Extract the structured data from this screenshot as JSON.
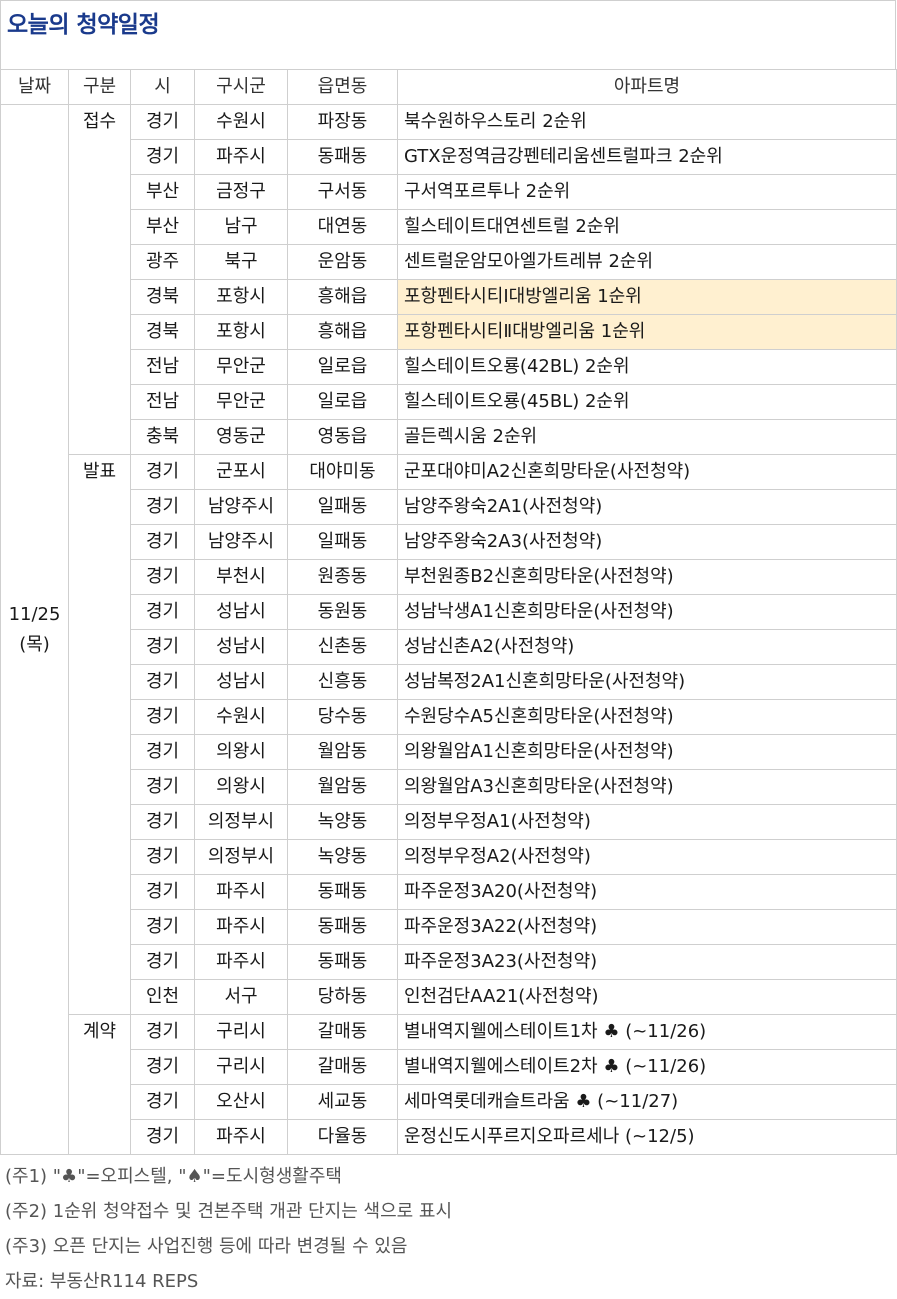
{
  "title": "오늘의 청약일정",
  "headers": [
    "날짜",
    "구분",
    "시",
    "구시군",
    "읍면동",
    "아파트명"
  ],
  "date": {
    "day": "11/25",
    "weekday": "(목)"
  },
  "groups": [
    {
      "label": "접수",
      "rows": [
        {
          "si": "경기",
          "gu": "수원시",
          "dong": "파장동",
          "apt": "북수원하우스토리 2순위",
          "highlight": false
        },
        {
          "si": "경기",
          "gu": "파주시",
          "dong": "동패동",
          "apt": "GTX운정역금강펜테리움센트럴파크 2순위",
          "highlight": false
        },
        {
          "si": "부산",
          "gu": "금정구",
          "dong": "구서동",
          "apt": "구서역포르투나 2순위",
          "highlight": false
        },
        {
          "si": "부산",
          "gu": "남구",
          "dong": "대연동",
          "apt": "힐스테이트대연센트럴 2순위",
          "highlight": false
        },
        {
          "si": "광주",
          "gu": "북구",
          "dong": "운암동",
          "apt": "센트럴운암모아엘가트레뷰 2순위",
          "highlight": false
        },
        {
          "si": "경북",
          "gu": "포항시",
          "dong": "흥해읍",
          "apt": "포항펜타시티Ⅰ대방엘리움 1순위",
          "highlight": true
        },
        {
          "si": "경북",
          "gu": "포항시",
          "dong": "흥해읍",
          "apt": "포항펜타시티Ⅱ대방엘리움 1순위",
          "highlight": true
        },
        {
          "si": "전남",
          "gu": "무안군",
          "dong": "일로읍",
          "apt": "힐스테이트오룡(42BL) 2순위",
          "highlight": false
        },
        {
          "si": "전남",
          "gu": "무안군",
          "dong": "일로읍",
          "apt": "힐스테이트오룡(45BL) 2순위",
          "highlight": false
        },
        {
          "si": "충북",
          "gu": "영동군",
          "dong": "영동읍",
          "apt": "골든렉시움 2순위",
          "highlight": false
        }
      ]
    },
    {
      "label": "발표",
      "rows": [
        {
          "si": "경기",
          "gu": "군포시",
          "dong": "대야미동",
          "apt": "군포대야미A2신혼희망타운(사전청약)",
          "highlight": false
        },
        {
          "si": "경기",
          "gu": "남양주시",
          "dong": "일패동",
          "apt": "남양주왕숙2A1(사전청약)",
          "highlight": false
        },
        {
          "si": "경기",
          "gu": "남양주시",
          "dong": "일패동",
          "apt": "남양주왕숙2A3(사전청약)",
          "highlight": false
        },
        {
          "si": "경기",
          "gu": "부천시",
          "dong": "원종동",
          "apt": "부천원종B2신혼희망타운(사전청약)",
          "highlight": false
        },
        {
          "si": "경기",
          "gu": "성남시",
          "dong": "동원동",
          "apt": "성남낙생A1신혼희망타운(사전청약)",
          "highlight": false
        },
        {
          "si": "경기",
          "gu": "성남시",
          "dong": "신촌동",
          "apt": "성남신촌A2(사전청약)",
          "highlight": false
        },
        {
          "si": "경기",
          "gu": "성남시",
          "dong": "신흥동",
          "apt": "성남복정2A1신혼희망타운(사전청약)",
          "highlight": false
        },
        {
          "si": "경기",
          "gu": "수원시",
          "dong": "당수동",
          "apt": "수원당수A5신혼희망타운(사전청약)",
          "highlight": false
        },
        {
          "si": "경기",
          "gu": "의왕시",
          "dong": "월암동",
          "apt": "의왕월암A1신혼희망타운(사전청약)",
          "highlight": false
        },
        {
          "si": "경기",
          "gu": "의왕시",
          "dong": "월암동",
          "apt": "의왕월암A3신혼희망타운(사전청약)",
          "highlight": false
        },
        {
          "si": "경기",
          "gu": "의정부시",
          "dong": "녹양동",
          "apt": "의정부우정A1(사전청약)",
          "highlight": false
        },
        {
          "si": "경기",
          "gu": "의정부시",
          "dong": "녹양동",
          "apt": "의정부우정A2(사전청약)",
          "highlight": false
        },
        {
          "si": "경기",
          "gu": "파주시",
          "dong": "동패동",
          "apt": "파주운정3A20(사전청약)",
          "highlight": false
        },
        {
          "si": "경기",
          "gu": "파주시",
          "dong": "동패동",
          "apt": "파주운정3A22(사전청약)",
          "highlight": false
        },
        {
          "si": "경기",
          "gu": "파주시",
          "dong": "동패동",
          "apt": "파주운정3A23(사전청약)",
          "highlight": false
        },
        {
          "si": "인천",
          "gu": "서구",
          "dong": "당하동",
          "apt": "인천검단AA21(사전청약)",
          "highlight": false
        }
      ]
    },
    {
      "label": "계약",
      "rows": [
        {
          "si": "경기",
          "gu": "구리시",
          "dong": "갈매동",
          "apt": "별내역지웰에스테이트1차 ♣  (~11/26)",
          "highlight": false
        },
        {
          "si": "경기",
          "gu": "구리시",
          "dong": "갈매동",
          "apt": "별내역지웰에스테이트2차 ♣  (~11/26)",
          "highlight": false
        },
        {
          "si": "경기",
          "gu": "오산시",
          "dong": "세교동",
          "apt": "세마역롯데캐슬트라움 ♣  (~11/27)",
          "highlight": false
        },
        {
          "si": "경기",
          "gu": "파주시",
          "dong": "다율동",
          "apt": "운정신도시푸르지오파르세나  (~12/5)",
          "highlight": false
        }
      ]
    }
  ],
  "notes": [
    "(주1) \"♣\"=오피스텔, \"♠\"=도시형생활주택",
    "(주2) 1순위 청약접수 및 견본주택 개관 단지는 색으로 표시",
    "(주3) 오픈 단지는 사업진행 등에 따라 변경될 수 있음",
    "자료: 부동산R114 REPS"
  ],
  "colors": {
    "title": "#1a3a8c",
    "highlight": "#fff0d0",
    "border": "#cfcfcf"
  }
}
